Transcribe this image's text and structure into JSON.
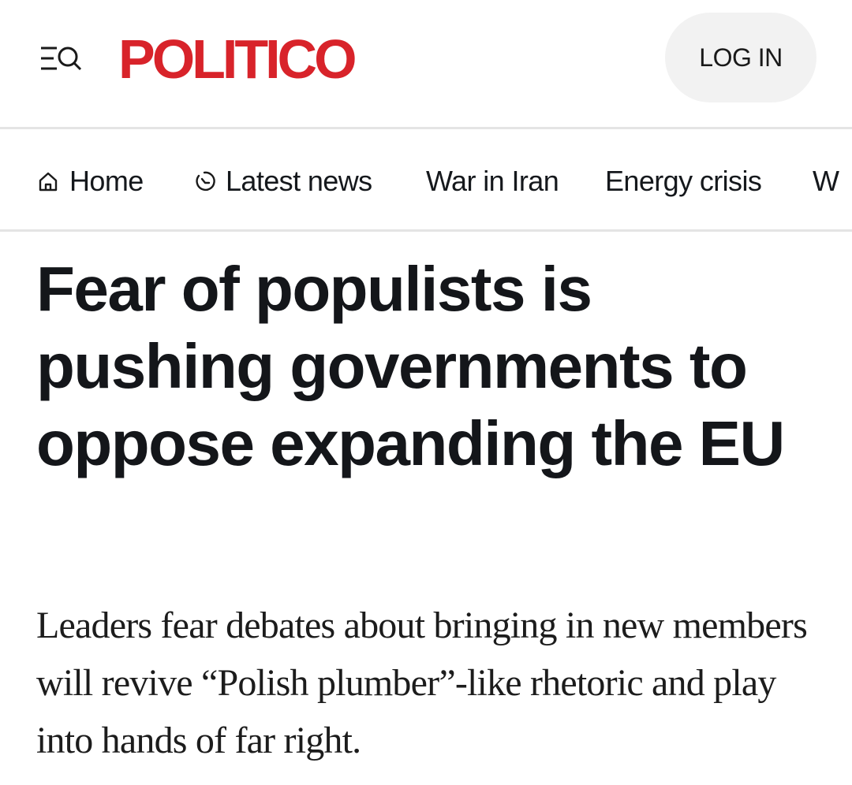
{
  "header": {
    "menu_search_icon": "menu-search-icon",
    "logo_text": "POLITICO",
    "logo_color": "#d8232a",
    "login_label": "LOG IN"
  },
  "nav": {
    "items": [
      {
        "label": "Home",
        "icon": "home-icon"
      },
      {
        "label": "Latest news",
        "icon": "clock-icon"
      },
      {
        "label": "War in Iran"
      },
      {
        "label": "Energy crisis"
      },
      {
        "label": "W"
      }
    ]
  },
  "article": {
    "headline": "Fear of populists is pushing governments to oppose expanding the EU",
    "dek": "Leaders fear debates about bringing in new members will revive “Polish plumber”-like rhetoric and play into hands of far right."
  }
}
